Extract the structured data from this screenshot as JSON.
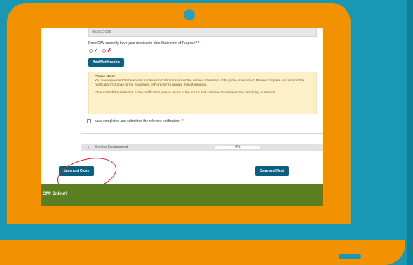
{
  "form": {
    "date_value": "08/01/2025",
    "question": "Does CIW currently have your most up to date Statement of Purpose?",
    "required_mark": "*",
    "radio_yes_mark": "✓",
    "radio_no_mark": "✗",
    "add_notification_label": "Add Notification",
    "note": {
      "title": "Please Note!",
      "body": "You have specified that some/all information CIW holds about the service Statement of Purpose is incorrect. Please complete and submit the notification 'Change to the Statement of Purpose' to update this information.",
      "body2": "On successful submission of the notification please return to the SASS and continue to complete the remaining questions."
    },
    "confirm_label": "I have completed and submitted the relevant notification."
  },
  "accordion": {
    "icon": "plus-icon",
    "plus": "+",
    "label": "Service Environment",
    "progress": "0%"
  },
  "buttons": {
    "save_close": "Save and Close",
    "save_next": "Save and Next"
  },
  "footer": {
    "text": "CIW Online?"
  },
  "colors": {
    "laptop_frame": "#f39200",
    "background": "#1a98b3",
    "button": "#0d5f80",
    "footer": "#5c7e22",
    "highlight_ring": "#e01e1e"
  }
}
